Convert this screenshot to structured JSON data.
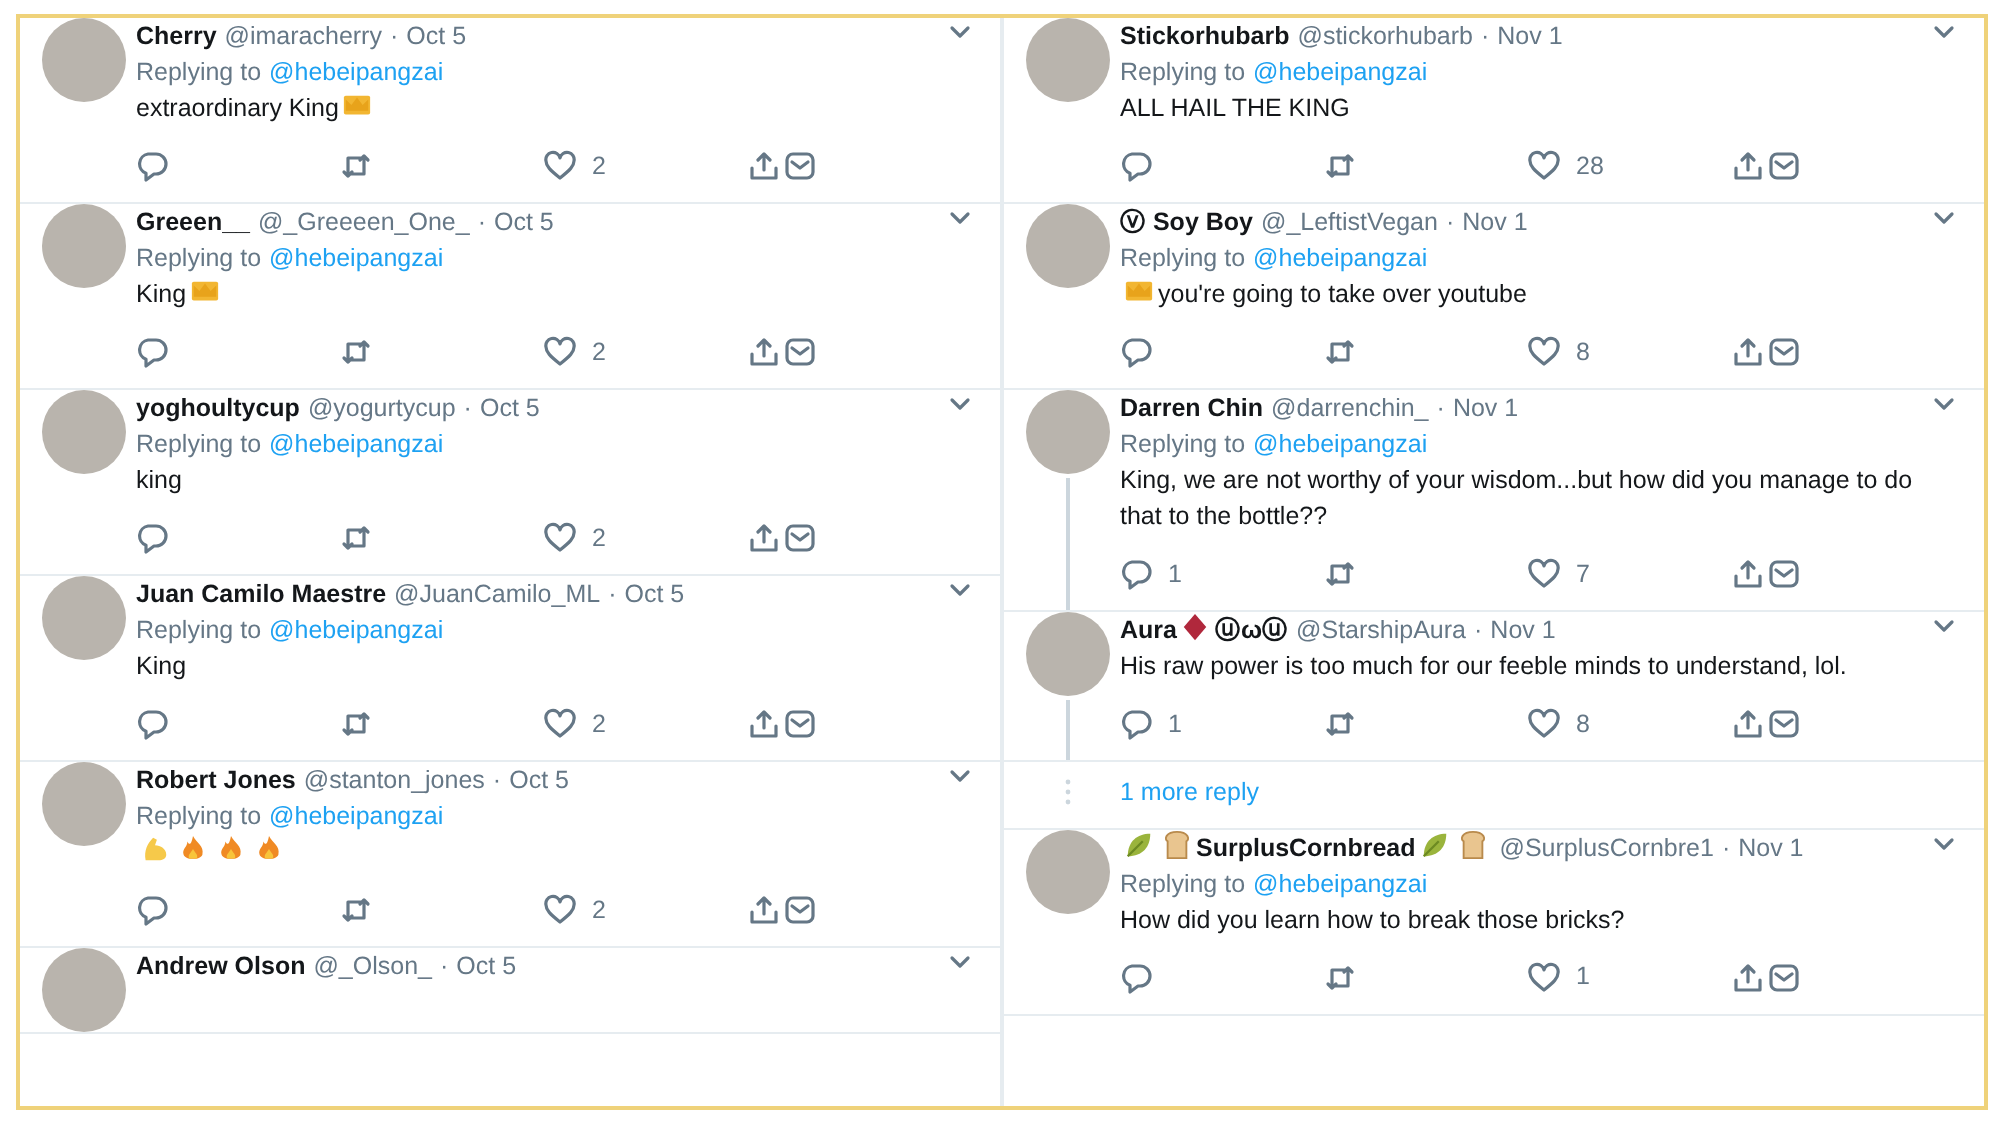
{
  "columns": [
    {
      "items": [
        {
          "kind": "tweet",
          "name": [
            {
              "kind": "text",
              "text": "Cherry"
            }
          ],
          "handle": "@imaracherry",
          "separator": "·",
          "date": "Oct 5",
          "reply_label": "Replying to",
          "reply_to": "@hebeipangzai",
          "body": [
            {
              "kind": "text",
              "text": "extraordinary King"
            },
            {
              "kind": "crown"
            }
          ],
          "actions": {
            "likes": "2"
          }
        },
        {
          "kind": "tweet",
          "name": [
            {
              "kind": "text",
              "text": "Greeen__"
            }
          ],
          "handle": "@_Greeeen_One_",
          "separator": "·",
          "date": "Oct 5",
          "reply_label": "Replying to",
          "reply_to": "@hebeipangzai",
          "body": [
            {
              "kind": "text",
              "text": "King"
            },
            {
              "kind": "crown"
            }
          ],
          "actions": {
            "likes": "2"
          }
        },
        {
          "kind": "tweet",
          "name": [
            {
              "kind": "text",
              "text": "yoghoultycup"
            }
          ],
          "handle": "@yogurtycup",
          "separator": "·",
          "date": "Oct 5",
          "reply_label": "Replying to",
          "reply_to": "@hebeipangzai",
          "body": [
            {
              "kind": "text",
              "text": "king"
            }
          ],
          "actions": {
            "likes": "2"
          }
        },
        {
          "kind": "tweet",
          "name": [
            {
              "kind": "text",
              "text": "Juan Camilo Maestre"
            }
          ],
          "handle": "@JuanCamilo_ML",
          "separator": "·",
          "date": "Oct 5",
          "reply_label": "Replying to",
          "reply_to": "@hebeipangzai",
          "body": [
            {
              "kind": "text",
              "text": "King"
            }
          ],
          "actions": {
            "likes": "2"
          }
        },
        {
          "kind": "tweet",
          "name": [
            {
              "kind": "text",
              "text": "Robert Jones"
            }
          ],
          "handle": "@stanton_jones",
          "separator": "·",
          "date": "Oct 5",
          "reply_label": "Replying to",
          "reply_to": "@hebeipangzai",
          "body": [
            {
              "kind": "flex"
            },
            {
              "kind": "fire"
            },
            {
              "kind": "fire"
            },
            {
              "kind": "fire"
            }
          ],
          "actions": {
            "likes": "2"
          }
        },
        {
          "kind": "tweet",
          "name": [
            {
              "kind": "text",
              "text": "Andrew Olson"
            }
          ],
          "handle": "@_Olson_",
          "separator": "·",
          "date": "Oct 5"
        }
      ]
    },
    {
      "items": [
        {
          "kind": "tweet",
          "name": [
            {
              "kind": "text",
              "text": "Stickorhubarb"
            }
          ],
          "handle": "@stickorhubarb",
          "separator": "·",
          "date": "Nov 1",
          "reply_label": "Replying to",
          "reply_to": "@hebeipangzai",
          "body": [
            {
              "kind": "text",
              "text": "ALL HAIL THE KING"
            }
          ],
          "actions": {
            "likes": "28"
          }
        },
        {
          "kind": "tweet",
          "name": [
            {
              "kind": "text",
              "text": "ⓥ Soy Boy"
            }
          ],
          "handle": "@_LeftistVegan",
          "separator": "·",
          "date": "Nov 1",
          "reply_label": "Replying to",
          "reply_to": "@hebeipangzai",
          "body": [
            {
              "kind": "crown"
            },
            {
              "kind": "text",
              "text": "you're going to take over youtube"
            }
          ],
          "actions": {
            "likes": "8"
          }
        },
        {
          "kind": "tweet",
          "thread": true,
          "name": [
            {
              "kind": "text",
              "text": "Darren Chin"
            }
          ],
          "handle": "@darrenchin_",
          "separator": "·",
          "date": "Nov 1",
          "reply_label": "Replying to",
          "reply_to": "@hebeipangzai",
          "body": [
            {
              "kind": "text",
              "text": "King, we are not worthy of your wisdom...but how did you manage to do that to the bottle??"
            }
          ],
          "actions": {
            "replies": "1",
            "likes": "7"
          }
        },
        {
          "kind": "tweet",
          "thread": true,
          "name": [
            {
              "kind": "text",
              "text": "Aura"
            },
            {
              "kind": "diamond"
            },
            {
              "kind": "text",
              "text": "ⓤωⓤ"
            }
          ],
          "handle": "@StarshipAura",
          "separator": "·",
          "date": "Nov 1",
          "body": [
            {
              "kind": "text",
              "text": "His raw power is too much for our feeble minds to understand, lol."
            }
          ],
          "actions": {
            "replies": "1",
            "likes": "8"
          }
        },
        {
          "kind": "more",
          "label": "1 more reply"
        },
        {
          "kind": "tweet",
          "name": [
            {
              "kind": "leaf"
            },
            {
              "kind": "bread"
            },
            {
              "kind": "text",
              "text": "SurplusCornbread"
            },
            {
              "kind": "leaf"
            },
            {
              "kind": "bread"
            }
          ],
          "handle": "@SurplusCornbre1",
          "separator": "·",
          "date": "Nov 1",
          "reply_label": "Replying to",
          "reply_to": "@hebeipangzai",
          "body": [
            {
              "kind": "text",
              "text": "How did you learn how to break those bricks?"
            }
          ],
          "actions": {
            "likes": "1"
          }
        }
      ]
    }
  ]
}
